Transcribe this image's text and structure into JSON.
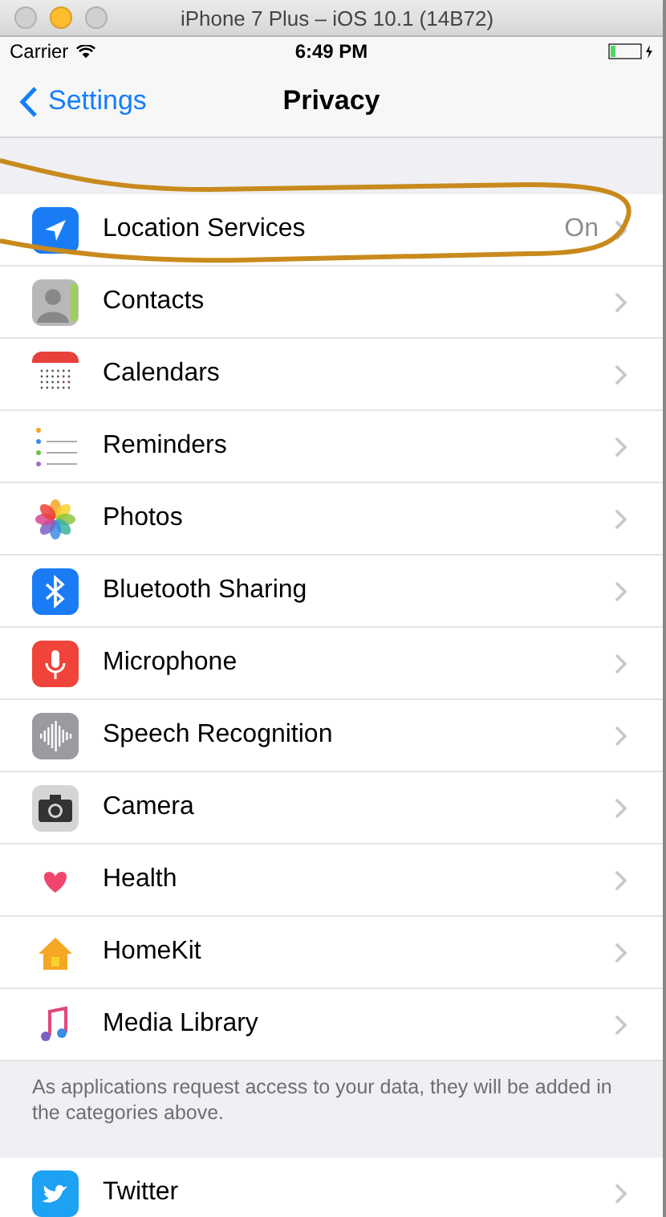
{
  "window": {
    "title": "iPhone 7 Plus – iOS 10.1 (14B72)",
    "buttons": [
      {
        "active": false
      },
      {
        "active": true
      },
      {
        "active": false
      }
    ]
  },
  "status_bar": {
    "carrier": "Carrier",
    "time": "6:49 PM",
    "charging": true
  },
  "nav": {
    "back": "Settings",
    "title": "Privacy"
  },
  "rows": [
    {
      "kind": "location",
      "label": "Location Services",
      "value": "On",
      "circled": true
    },
    {
      "kind": "contacts",
      "label": "Contacts",
      "circled": false
    },
    {
      "kind": "calendars",
      "label": "Calendars",
      "circled": false
    },
    {
      "kind": "reminders",
      "label": "Reminders",
      "circled": false
    },
    {
      "kind": "photos",
      "label": "Photos",
      "circled": false
    },
    {
      "kind": "bluetooth",
      "label": "Bluetooth Sharing",
      "circled": false
    },
    {
      "kind": "microphone",
      "label": "Microphone",
      "circled": false
    },
    {
      "kind": "speech",
      "label": "Speech Recognition",
      "circled": false
    },
    {
      "kind": "camera",
      "label": "Camera",
      "circled": false
    },
    {
      "kind": "health",
      "label": "Health",
      "circled": false
    },
    {
      "kind": "homekit",
      "label": "HomeKit",
      "circled": false
    },
    {
      "kind": "music",
      "label": "Media Library",
      "circled": false
    }
  ],
  "footer": "As applications request access to your data, they will be added in the categories above.",
  "rows_2": [
    {
      "kind": "twitter",
      "label": "Twitter",
      "circled": false
    }
  ]
}
